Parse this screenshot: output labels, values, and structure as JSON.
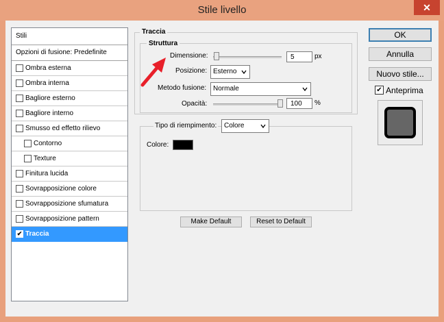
{
  "window": {
    "title": "Stile livello",
    "close_glyph": "✕"
  },
  "styles_panel": {
    "header": "Stili",
    "blending_options": "Opzioni di fusione: Predefinite",
    "items": [
      {
        "label": "Ombra esterna",
        "checked": false,
        "indent": false
      },
      {
        "label": "Ombra interna",
        "checked": false,
        "indent": false
      },
      {
        "label": "Bagliore esterno",
        "checked": false,
        "indent": false
      },
      {
        "label": "Bagliore interno",
        "checked": false,
        "indent": false
      },
      {
        "label": "Smusso ed effetto rilievo",
        "checked": false,
        "indent": false
      },
      {
        "label": "Contorno",
        "checked": false,
        "indent": true
      },
      {
        "label": "Texture",
        "checked": false,
        "indent": true
      },
      {
        "label": "Finitura lucida",
        "checked": false,
        "indent": false
      },
      {
        "label": "Sovrapposizione colore",
        "checked": false,
        "indent": false
      },
      {
        "label": "Sovrapposizione sfumatura",
        "checked": false,
        "indent": false
      },
      {
        "label": "Sovrapposizione pattern",
        "checked": false,
        "indent": false
      },
      {
        "label": "Traccia",
        "checked": true,
        "indent": false,
        "selected": true
      }
    ]
  },
  "stroke": {
    "title": "Traccia",
    "structure_title": "Struttura",
    "size_label": "Dimensione:",
    "size_value": "5",
    "size_unit": "px",
    "position_label": "Posizione:",
    "position_value": "Esterno",
    "blend_mode_label": "Metodo fusione:",
    "blend_mode_value": "Normale",
    "opacity_label": "Opacità:",
    "opacity_value": "100",
    "opacity_unit": "%",
    "fill_type_label": "Tipo di riempimento:",
    "fill_type_value": "Colore",
    "color_label": "Colore:",
    "color_value": "#000000",
    "make_default": "Make Default",
    "reset_default": "Reset to Default"
  },
  "actions": {
    "ok": "OK",
    "cancel": "Annulla",
    "new_style": "Nuovo stile...",
    "preview_label": "Anteprima",
    "preview_checked": true,
    "check_glyph": "✔"
  },
  "colors": {
    "accent": "#3399ff",
    "titlebar": "#e9a27f",
    "close": "#c7432f",
    "arrow": "#e8202a"
  }
}
